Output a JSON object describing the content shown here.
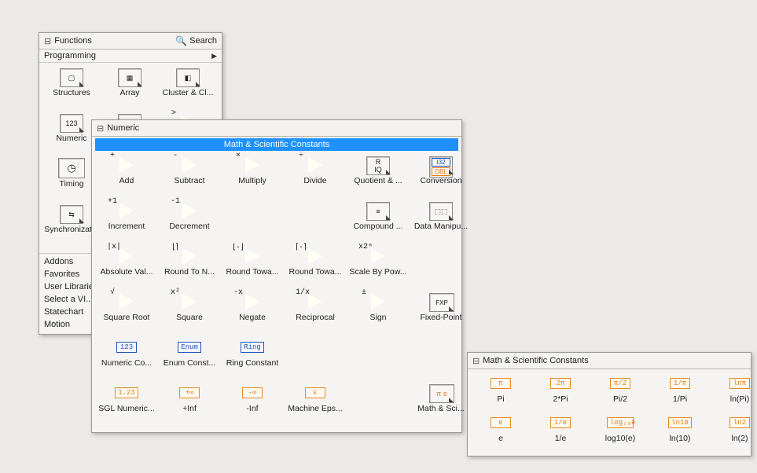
{
  "functions_panel": {
    "title": "Functions",
    "search_label": "Search",
    "subheader": "Programming",
    "items": [
      {
        "label": "Structures",
        "kind": "framed",
        "glyph": "▢"
      },
      {
        "label": "Array",
        "kind": "framed",
        "glyph": "▦"
      },
      {
        "label": "Cluster & Cl...",
        "kind": "framed",
        "glyph": "◧"
      },
      {
        "label": "Numeric",
        "kind": "framed",
        "glyph": "123"
      },
      {
        "label": "",
        "kind": "framed",
        "glyph": "TF"
      },
      {
        "label": "",
        "kind": "tri",
        "sym": ">"
      },
      {
        "label": "Timing",
        "kind": "special",
        "glyph": "◷"
      },
      {
        "label": "",
        "kind": "empty"
      },
      {
        "label": "",
        "kind": "empty"
      },
      {
        "label": "Synchronizat...",
        "kind": "framed",
        "glyph": "⇆"
      },
      {
        "label": "",
        "kind": "empty"
      },
      {
        "label": "",
        "kind": "empty"
      }
    ],
    "bottom_list": [
      "Addons",
      "Favorites",
      "User Libraries",
      "Select a VI...",
      "Statechart",
      "Motion"
    ]
  },
  "numeric_panel": {
    "title": "Numeric",
    "highlight": "Math & Scientific Constants",
    "rows": [
      [
        {
          "label": "Add",
          "kind": "tri",
          "sym": "+"
        },
        {
          "label": "Subtract",
          "kind": "tri",
          "sym": "-"
        },
        {
          "label": "Multiply",
          "kind": "tri",
          "sym": "×"
        },
        {
          "label": "Divide",
          "kind": "tri",
          "sym": "÷"
        },
        {
          "label": "Quotient & ...",
          "kind": "framed",
          "glyph": "R\nIQ"
        },
        {
          "label": "Conversion",
          "kind": "conv"
        }
      ],
      [
        {
          "label": "Increment",
          "kind": "tri",
          "sym": "+1"
        },
        {
          "label": "Decrement",
          "kind": "tri",
          "sym": "-1"
        },
        {
          "label": "",
          "kind": "empty"
        },
        {
          "label": "",
          "kind": "empty"
        },
        {
          "label": "Compound ...",
          "kind": "framed",
          "glyph": "≡"
        },
        {
          "label": "Data Manipu...",
          "kind": "framed",
          "glyph": "⬚⬚"
        }
      ],
      [
        {
          "label": "Absolute Val...",
          "kind": "tri",
          "sym": "|x|"
        },
        {
          "label": "Round To N...",
          "kind": "tri",
          "sym": "⌊⌉"
        },
        {
          "label": "Round Towa...",
          "kind": "tri",
          "sym": "⌊·⌋"
        },
        {
          "label": "Round Towa...",
          "kind": "tri",
          "sym": "⌈·⌉"
        },
        {
          "label": "Scale By Pow...",
          "kind": "tri",
          "sym": "x2ⁿ"
        },
        {
          "label": "",
          "kind": "empty"
        }
      ],
      [
        {
          "label": "Square Root",
          "kind": "tri",
          "sym": "√"
        },
        {
          "label": "Square",
          "kind": "tri",
          "sym": "x²"
        },
        {
          "label": "Negate",
          "kind": "tri",
          "sym": "-x"
        },
        {
          "label": "Reciprocal",
          "kind": "tri",
          "sym": "1/x"
        },
        {
          "label": "Sign",
          "kind": "tri",
          "sym": "±"
        },
        {
          "label": "Fixed-Point",
          "kind": "fxp"
        }
      ],
      [
        {
          "label": "Numeric Co...",
          "kind": "bluebox",
          "txt": "123"
        },
        {
          "label": "Enum Const...",
          "kind": "bluebox",
          "txt": "Enum"
        },
        {
          "label": "Ring Constant",
          "kind": "bluebox",
          "txt": "Ring"
        },
        {
          "label": "",
          "kind": "empty"
        },
        {
          "label": "",
          "kind": "empty"
        },
        {
          "label": "",
          "kind": "empty"
        }
      ],
      [
        {
          "label": "SGL Numeric...",
          "kind": "orangesmall",
          "txt": "1.23"
        },
        {
          "label": "+Inf",
          "kind": "orangesmall",
          "txt": "+∞"
        },
        {
          "label": "-Inf",
          "kind": "orangesmall",
          "txt": "-∞"
        },
        {
          "label": "Machine Eps...",
          "kind": "orangesmall",
          "txt": "ε"
        },
        {
          "label": "",
          "kind": "empty"
        },
        {
          "label": "Math & Sci...",
          "kind": "mathsub"
        }
      ]
    ]
  },
  "math_panel": {
    "title": "Math & Scientific Constants",
    "rows": [
      [
        {
          "label": "Pi",
          "txt": "π"
        },
        {
          "label": "2*Pi",
          "txt": "2π"
        },
        {
          "label": "Pi/2",
          "txt": "π/2"
        },
        {
          "label": "1/Pi",
          "txt": "1/π"
        },
        {
          "label": "ln(Pi)",
          "txt": "lnπ"
        }
      ],
      [
        {
          "label": "e",
          "txt": "e"
        },
        {
          "label": "1/e",
          "txt": "1/e"
        },
        {
          "label": "log10(e)",
          "txt": "log₁₀e"
        },
        {
          "label": "ln(10)",
          "txt": "ln10"
        },
        {
          "label": "ln(2)",
          "txt": "ln2"
        }
      ]
    ]
  }
}
